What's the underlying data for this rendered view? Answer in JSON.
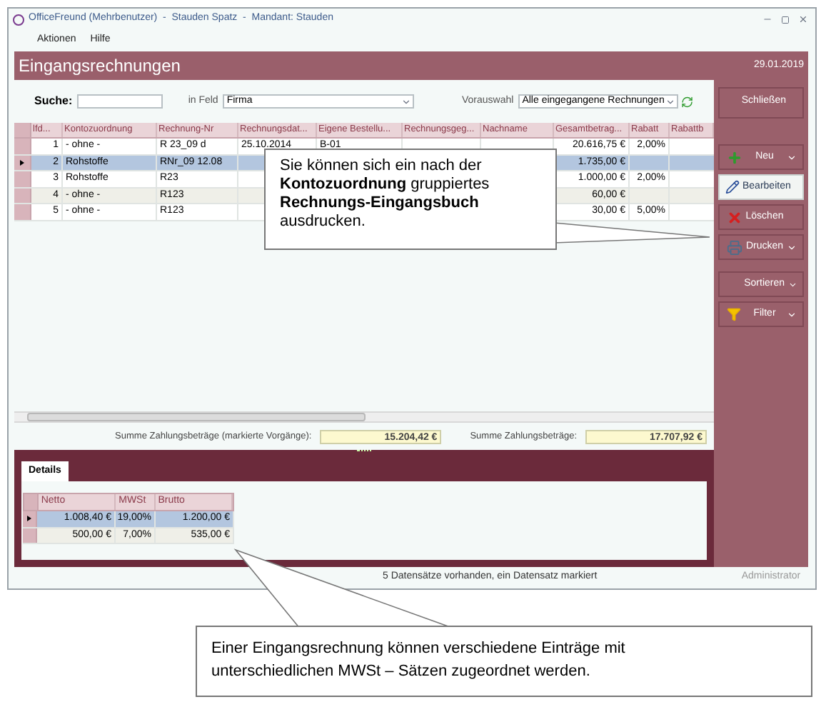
{
  "window": {
    "title": "OfficeFreund (Mehrbenutzer)  -  Stauden Spatz  -  Mandant: Stauden"
  },
  "menu": [
    "Aktionen",
    "Hilfe"
  ],
  "header": {
    "title": "Eingangsrechnungen",
    "date": "29.01.2019"
  },
  "search": {
    "label": "Suche:",
    "field_label": "in Feld",
    "field_value": "Firma",
    "preset_label": "Vorauswahl",
    "preset_value": "Alle eingegangene Rechnungen"
  },
  "table": {
    "columns": [
      "lfd...",
      "Kontozuordnung",
      "Rechnung-Nr",
      "Rechnungsdat...",
      "Eigene Bestellu...",
      "Rechnungsgeg...",
      "Nachname",
      "Gesamtbetrag...",
      "Rabatt",
      "Rabattb"
    ],
    "rows": [
      {
        "selected": false,
        "cells": [
          "1",
          "- ohne -",
          "R 23_09 d",
          "25.10.2014",
          "B-01",
          "",
          "",
          "20.616,75 €",
          "2,00%"
        ]
      },
      {
        "selected": true,
        "cells": [
          "2",
          "Rohstoffe",
          "RNr_09 12.08",
          "",
          "",
          "",
          "",
          "1.735,00 €",
          ""
        ]
      },
      {
        "selected": false,
        "cells": [
          "3",
          "Rohstoffe",
          "R23",
          "",
          "",
          "",
          "",
          "1.000,00 €",
          "2,00%"
        ]
      },
      {
        "selected": false,
        "cells": [
          "4",
          "- ohne -",
          "R123",
          "",
          "",
          "",
          "",
          "60,00 €",
          ""
        ]
      },
      {
        "selected": false,
        "cells": [
          "5",
          "- ohne -",
          "R123",
          "",
          "",
          "",
          "",
          "30,00 €",
          "5,00%"
        ]
      }
    ]
  },
  "sums": [
    {
      "label": "Summe Zahlungsbeträge (markierte Vorgänge):",
      "value": "15.204,42 €"
    },
    {
      "label": "Summe Zahlungsbeträge:",
      "value": "17.707,92 €"
    }
  ],
  "sidebar": [
    {
      "label": "Schließen",
      "kind": "plain",
      "selected": false
    },
    {
      "label": "Neu",
      "kind": "plus",
      "selected": false
    },
    {
      "label": "Bearbeiten",
      "kind": "pen",
      "selected": true
    },
    {
      "label": "Löschen",
      "kind": "delete",
      "selected": false
    },
    {
      "label": "Drucken",
      "kind": "print",
      "selected": false
    },
    {
      "label": "Sortieren",
      "kind": "menu",
      "selected": false
    },
    {
      "label": "Filter",
      "kind": "filter",
      "selected": false
    }
  ],
  "details": {
    "tab": {
      "label": "Details",
      "selected": true
    },
    "columns": [
      "Netto",
      "MWSt",
      "Brutto"
    ],
    "rows": [
      {
        "selected": true,
        "cells": [
          "1.008,40 €",
          "19,00%",
          "1.200,00 €"
        ]
      },
      {
        "selected": false,
        "cells": [
          "500,00 €",
          "7,00%",
          "535,00 €"
        ]
      }
    ]
  },
  "status_bar": {
    "message": "5 Datensätze vorhanden, ein Datensatz markiert",
    "user": "Administrator"
  },
  "callouts": [
    "Sie können sich ein nach der **Kontozuordnung** gruppiertes **Rechnungs-Eingangsbuch** ausdrucken.",
    "Einer Eingangsrechnung können verschiedene Einträge mit unterschiedlichen MWSt – Sätzen zugeordnet werden."
  ]
}
